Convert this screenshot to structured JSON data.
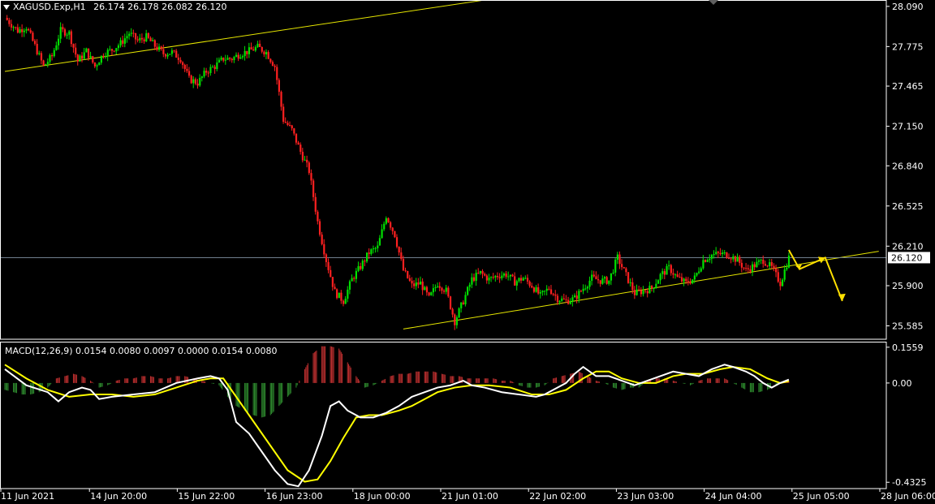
{
  "header": {
    "symbol_timeframe": "XAGUSD.Exp,H1",
    "ohlc": "26.174 26.178 26.082 26.120"
  },
  "macd": {
    "label": "MACD(12,26,9) 0.0154 0.0080 0.0097 0.0000 0.0154 0.0080"
  },
  "colors": {
    "background": "#000000",
    "bull": "#00e000",
    "bear": "#ff2020",
    "trendline": "#e6e600",
    "arrow": "#ffe000",
    "macd_main": "#ffffff",
    "macd_signal": "#ffff00",
    "hist_pos": "#c03030",
    "hist_neg": "#2e8b2e"
  },
  "chart_data": {
    "type": "candlestick",
    "instrument": "XAGUSD.Exp",
    "timeframe": "H1",
    "price_axis_ticks": [
      "28.090",
      "27.775",
      "27.465",
      "27.150",
      "26.840",
      "26.525",
      "26.210",
      "25.900",
      "25.585"
    ],
    "price_range": [
      25.48,
      28.14
    ],
    "current_price": "26.120",
    "time_axis_ticks": [
      "11 Jun 2021",
      "14 Jun 20:00",
      "15 Jun 22:00",
      "16 Jun 23:00",
      "18 Jun 00:00",
      "21 Jun 01:00",
      "22 Jun 02:00",
      "23 Jun 03:00",
      "24 Jun 04:00",
      "25 Jun 05:00",
      "28 Jun 06:00"
    ],
    "price_path": [
      [
        0,
        28.0
      ],
      [
        6,
        27.9
      ],
      [
        10,
        27.93
      ],
      [
        14,
        27.78
      ],
      [
        18,
        27.62
      ],
      [
        22,
        27.7
      ],
      [
        26,
        27.9
      ],
      [
        30,
        27.88
      ],
      [
        34,
        27.66
      ],
      [
        38,
        27.74
      ],
      [
        42,
        27.62
      ],
      [
        46,
        27.72
      ],
      [
        50,
        27.75
      ],
      [
        54,
        27.8
      ],
      [
        58,
        27.88
      ],
      [
        62,
        27.82
      ],
      [
        66,
        27.85
      ],
      [
        70,
        27.78
      ],
      [
        74,
        27.72
      ],
      [
        78,
        27.73
      ],
      [
        82,
        27.68
      ],
      [
        86,
        27.52
      ],
      [
        90,
        27.49
      ],
      [
        94,
        27.58
      ],
      [
        98,
        27.62
      ],
      [
        102,
        27.68
      ],
      [
        106,
        27.68
      ],
      [
        110,
        27.72
      ],
      [
        114,
        27.74
      ],
      [
        118,
        27.77
      ],
      [
        122,
        27.73
      ],
      [
        126,
        27.62
      ],
      [
        130,
        27.2
      ],
      [
        134,
        27.12
      ],
      [
        138,
        26.95
      ],
      [
        142,
        26.8
      ],
      [
        146,
        26.4
      ],
      [
        150,
        26.1
      ],
      [
        154,
        25.85
      ],
      [
        158,
        25.78
      ],
      [
        162,
        25.95
      ],
      [
        166,
        26.05
      ],
      [
        170,
        26.16
      ],
      [
        174,
        26.2
      ],
      [
        178,
        26.45
      ],
      [
        182,
        26.3
      ],
      [
        186,
        26.02
      ],
      [
        190,
        25.9
      ],
      [
        194,
        25.92
      ],
      [
        198,
        25.8
      ],
      [
        202,
        25.92
      ],
      [
        206,
        25.86
      ],
      [
        210,
        25.62
      ],
      [
        214,
        25.78
      ],
      [
        218,
        25.95
      ],
      [
        222,
        26.0
      ],
      [
        226,
        25.95
      ],
      [
        230,
        25.98
      ],
      [
        234,
        25.99
      ],
      [
        238,
        25.93
      ],
      [
        242,
        25.96
      ],
      [
        246,
        25.9
      ],
      [
        250,
        25.82
      ],
      [
        254,
        25.88
      ],
      [
        258,
        25.8
      ],
      [
        262,
        25.78
      ],
      [
        266,
        25.8
      ],
      [
        270,
        25.88
      ],
      [
        274,
        25.96
      ],
      [
        278,
        25.94
      ],
      [
        282,
        25.94
      ],
      [
        286,
        26.12
      ],
      [
        290,
        25.98
      ],
      [
        294,
        25.84
      ],
      [
        298,
        25.86
      ],
      [
        302,
        25.88
      ],
      [
        306,
        25.98
      ],
      [
        310,
        26.04
      ],
      [
        314,
        25.96
      ],
      [
        318,
        25.92
      ],
      [
        322,
        25.96
      ],
      [
        326,
        26.1
      ],
      [
        330,
        26.14
      ],
      [
        334,
        26.15
      ],
      [
        338,
        26.14
      ],
      [
        342,
        26.1
      ],
      [
        346,
        26.02
      ],
      [
        350,
        26.06
      ],
      [
        354,
        26.1
      ],
      [
        358,
        26.04
      ],
      [
        362,
        25.92
      ],
      [
        366,
        26.12
      ]
    ],
    "trendlines": [
      {
        "from": [
          0,
          27.58
        ],
        "to": [
          224,
          28.14
        ]
      },
      {
        "from": [
          186,
          25.56
        ],
        "to": [
          408,
          26.17
        ]
      }
    ],
    "macd": {
      "name": "MACD(12,26,9)",
      "values": [
        "0.0154",
        "0.0080",
        "0.0097",
        "0.0000",
        "0.0154",
        "0.0080"
      ],
      "axis_ticks": [
        "0.1559",
        "0.00",
        "-0.4325"
      ],
      "range": [
        -0.46,
        0.18
      ],
      "main_path": [
        [
          0,
          0.06
        ],
        [
          10,
          -0.01
        ],
        [
          20,
          -0.04
        ],
        [
          25,
          -0.08
        ],
        [
          30,
          -0.04
        ],
        [
          36,
          -0.02
        ],
        [
          40,
          -0.03
        ],
        [
          44,
          -0.07
        ],
        [
          50,
          -0.06
        ],
        [
          60,
          -0.05
        ],
        [
          70,
          -0.04
        ],
        [
          80,
          0.0
        ],
        [
          90,
          0.02
        ],
        [
          96,
          0.03
        ],
        [
          100,
          0.02
        ],
        [
          104,
          -0.03
        ],
        [
          108,
          -0.17
        ],
        [
          114,
          -0.22
        ],
        [
          120,
          -0.3
        ],
        [
          126,
          -0.38
        ],
        [
          132,
          -0.44
        ],
        [
          137,
          -0.45
        ],
        [
          142,
          -0.38
        ],
        [
          148,
          -0.23
        ],
        [
          152,
          -0.1
        ],
        [
          156,
          -0.08
        ],
        [
          160,
          -0.12
        ],
        [
          166,
          -0.15
        ],
        [
          172,
          -0.15
        ],
        [
          178,
          -0.13
        ],
        [
          184,
          -0.1
        ],
        [
          190,
          -0.06
        ],
        [
          196,
          -0.04
        ],
        [
          202,
          -0.02
        ],
        [
          208,
          -0.01
        ],
        [
          214,
          0.01
        ],
        [
          218,
          -0.01
        ],
        [
          224,
          -0.02
        ],
        [
          232,
          -0.04
        ],
        [
          240,
          -0.05
        ],
        [
          248,
          -0.06
        ],
        [
          252,
          -0.05
        ],
        [
          256,
          -0.03
        ],
        [
          262,
          0.0
        ],
        [
          266,
          0.04
        ],
        [
          270,
          0.07
        ],
        [
          276,
          0.03
        ],
        [
          282,
          0.03
        ],
        [
          288,
          0.01
        ],
        [
          294,
          -0.01
        ],
        [
          300,
          0.01
        ],
        [
          306,
          0.03
        ],
        [
          312,
          0.05
        ],
        [
          318,
          0.04
        ],
        [
          324,
          0.03
        ],
        [
          330,
          0.06
        ],
        [
          336,
          0.08
        ],
        [
          340,
          0.07
        ],
        [
          346,
          0.05
        ],
        [
          350,
          0.03
        ],
        [
          354,
          0.0
        ],
        [
          358,
          -0.02
        ],
        [
          362,
          0.0
        ],
        [
          366,
          0.015
        ]
      ],
      "signal_path": [
        [
          0,
          0.08
        ],
        [
          10,
          0.02
        ],
        [
          20,
          -0.03
        ],
        [
          30,
          -0.06
        ],
        [
          40,
          -0.05
        ],
        [
          50,
          -0.05
        ],
        [
          60,
          -0.06
        ],
        [
          70,
          -0.05
        ],
        [
          80,
          -0.02
        ],
        [
          90,
          0.01
        ],
        [
          96,
          0.02
        ],
        [
          102,
          0.02
        ],
        [
          108,
          -0.06
        ],
        [
          114,
          -0.14
        ],
        [
          120,
          -0.22
        ],
        [
          126,
          -0.3
        ],
        [
          132,
          -0.38
        ],
        [
          140,
          -0.43
        ],
        [
          146,
          -0.42
        ],
        [
          152,
          -0.34
        ],
        [
          158,
          -0.24
        ],
        [
          164,
          -0.15
        ],
        [
          170,
          -0.14
        ],
        [
          176,
          -0.14
        ],
        [
          184,
          -0.12
        ],
        [
          190,
          -0.1
        ],
        [
          196,
          -0.07
        ],
        [
          202,
          -0.04
        ],
        [
          210,
          -0.02
        ],
        [
          218,
          -0.01
        ],
        [
          226,
          -0.01
        ],
        [
          236,
          -0.02
        ],
        [
          246,
          -0.05
        ],
        [
          254,
          -0.05
        ],
        [
          262,
          -0.03
        ],
        [
          270,
          0.02
        ],
        [
          276,
          0.05
        ],
        [
          282,
          0.05
        ],
        [
          288,
          0.02
        ],
        [
          296,
          0.0
        ],
        [
          304,
          0.0
        ],
        [
          312,
          0.03
        ],
        [
          318,
          0.04
        ],
        [
          326,
          0.04
        ],
        [
          334,
          0.06
        ],
        [
          340,
          0.07
        ],
        [
          348,
          0.06
        ],
        [
          356,
          0.02
        ],
        [
          362,
          0.0
        ],
        [
          366,
          0.008
        ]
      ],
      "hist_path": [
        [
          0,
          -0.03
        ],
        [
          4,
          -0.04
        ],
        [
          8,
          -0.05
        ],
        [
          12,
          -0.05
        ],
        [
          16,
          -0.04
        ],
        [
          20,
          -0.02
        ],
        [
          24,
          0.02
        ],
        [
          28,
          0.03
        ],
        [
          32,
          0.04
        ],
        [
          36,
          0.03
        ],
        [
          40,
          0.01
        ],
        [
          44,
          -0.02
        ],
        [
          48,
          -0.01
        ],
        [
          52,
          0.01
        ],
        [
          56,
          0.02
        ],
        [
          60,
          0.02
        ],
        [
          64,
          0.03
        ],
        [
          68,
          0.03
        ],
        [
          72,
          0.02
        ],
        [
          76,
          0.02
        ],
        [
          80,
          0.03
        ],
        [
          84,
          0.03
        ],
        [
          88,
          0.02
        ],
        [
          92,
          0.01
        ],
        [
          96,
          0.0
        ],
        [
          100,
          -0.01
        ],
        [
          104,
          -0.06
        ],
        [
          108,
          -0.1
        ],
        [
          112,
          -0.12
        ],
        [
          116,
          -0.14
        ],
        [
          120,
          -0.15
        ],
        [
          124,
          -0.14
        ],
        [
          128,
          -0.1
        ],
        [
          132,
          -0.06
        ],
        [
          136,
          -0.02
        ],
        [
          140,
          0.06
        ],
        [
          144,
          0.13
        ],
        [
          148,
          0.16
        ],
        [
          152,
          0.16
        ],
        [
          156,
          0.15
        ],
        [
          160,
          0.09
        ],
        [
          164,
          0.03
        ],
        [
          168,
          -0.02
        ],
        [
          172,
          -0.01
        ],
        [
          176,
          0.01
        ],
        [
          180,
          0.03
        ],
        [
          184,
          0.04
        ],
        [
          188,
          0.04
        ],
        [
          192,
          0.05
        ],
        [
          196,
          0.05
        ],
        [
          200,
          0.05
        ],
        [
          204,
          0.04
        ],
        [
          208,
          0.03
        ],
        [
          212,
          0.03
        ],
        [
          216,
          0.02
        ],
        [
          220,
          0.02
        ],
        [
          224,
          0.02
        ],
        [
          228,
          0.02
        ],
        [
          232,
          0.01
        ],
        [
          236,
          0.01
        ],
        [
          240,
          -0.01
        ],
        [
          244,
          -0.02
        ],
        [
          248,
          -0.02
        ],
        [
          252,
          -0.01
        ],
        [
          256,
          0.02
        ],
        [
          260,
          0.03
        ],
        [
          264,
          0.04
        ],
        [
          268,
          0.05
        ],
        [
          272,
          0.03
        ],
        [
          276,
          0.01
        ],
        [
          280,
          0.0
        ],
        [
          284,
          -0.02
        ],
        [
          288,
          -0.03
        ],
        [
          292,
          -0.02
        ],
        [
          296,
          -0.02
        ],
        [
          300,
          0.01
        ],
        [
          304,
          0.02
        ],
        [
          308,
          0.02
        ],
        [
          312,
          0.01
        ],
        [
          316,
          0.0
        ],
        [
          320,
          -0.01
        ],
        [
          324,
          0.01
        ],
        [
          328,
          0.02
        ],
        [
          332,
          0.02
        ],
        [
          336,
          0.02
        ],
        [
          340,
          0.0
        ],
        [
          344,
          -0.02
        ],
        [
          348,
          -0.04
        ],
        [
          352,
          -0.04
        ],
        [
          356,
          -0.03
        ],
        [
          360,
          -0.01
        ],
        [
          364,
          0.01
        ],
        [
          366,
          0.01
        ]
      ]
    }
  }
}
